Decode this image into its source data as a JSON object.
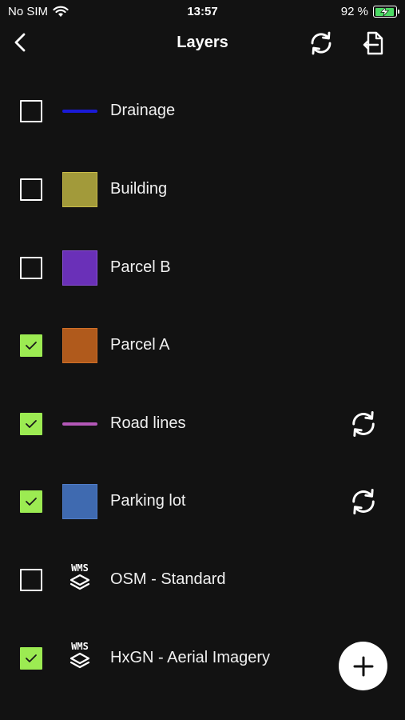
{
  "status": {
    "carrier": "No SIM",
    "time": "13:57",
    "battery": "92 %",
    "battery_level": 0.92
  },
  "nav": {
    "title": "Layers"
  },
  "layers": [
    {
      "label": "Drainage",
      "checked": false,
      "symbol": "line",
      "color": "#1a1ad6",
      "sync": false
    },
    {
      "label": "Building",
      "checked": false,
      "symbol": "fill",
      "color": "#a29a3a",
      "border": "#c8bb49",
      "sync": false
    },
    {
      "label": "Parcel B",
      "checked": false,
      "symbol": "fill",
      "color": "#6a30b8",
      "border": "#8b52d8",
      "sync": false
    },
    {
      "label": "Parcel A",
      "checked": true,
      "symbol": "fill",
      "color": "#b05a1c",
      "border": "#d06f28",
      "sync": false
    },
    {
      "label": "Road lines",
      "checked": true,
      "symbol": "line",
      "color": "#b458b8",
      "sync": true
    },
    {
      "label": "Parking lot",
      "checked": true,
      "symbol": "fill",
      "color": "#3f6ab0",
      "border": "#4f7cc8",
      "sync": true
    },
    {
      "label": "OSM - Standard",
      "checked": false,
      "symbol": "wms",
      "wms_text": "WMS",
      "sync": false
    },
    {
      "label": "HxGN - Aerial Imagery",
      "checked": true,
      "symbol": "wms",
      "wms_text": "WMS",
      "sync": false
    }
  ],
  "colors": {
    "background": "#121212",
    "checked": "#9ceb52",
    "fab": "#ffffff"
  },
  "icons": {
    "back": "chevron-left-icon",
    "refresh": "refresh-icon",
    "export": "export-icon",
    "add": "plus-icon"
  }
}
